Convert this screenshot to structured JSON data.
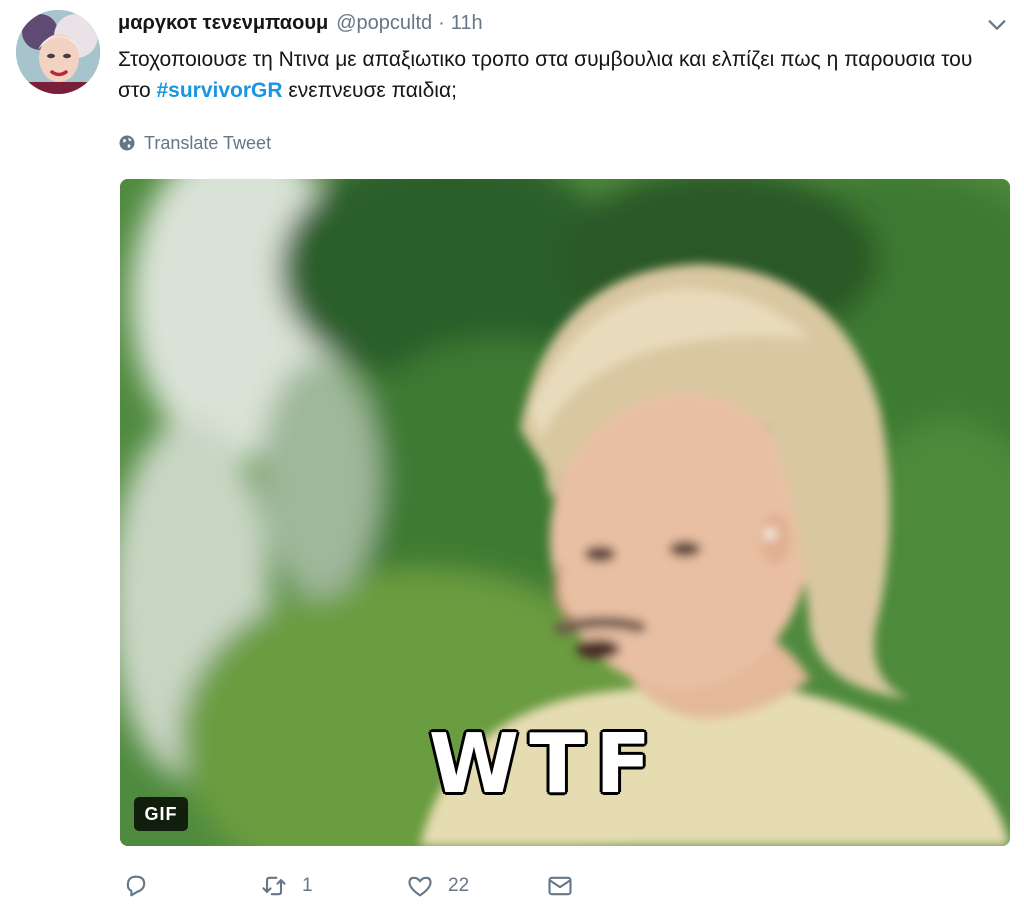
{
  "tweet": {
    "author_name": "μαργκοτ τενενμπαουμ",
    "handle": "@popcultd",
    "separator": "·",
    "time": "11h",
    "text_before": "Στοχοποιουσε τη Ντινα με απαξιωτικο τροπο στα συμβουλια και ελπίζει πως η παρουσια του στο ",
    "hashtag": "#survivorGR",
    "text_after": " ενεπνευσε παιδια;",
    "translate_label": "Translate Tweet",
    "media": {
      "caption": "WTF",
      "badge": "GIF"
    },
    "actions": {
      "reply_count": "",
      "retweet_count": "1",
      "like_count": "22"
    }
  },
  "icons": {
    "reply": "reply-icon",
    "retweet": "retweet-icon",
    "like": "heart-icon",
    "dm": "envelope-icon",
    "menu": "chevron-down-icon",
    "translate": "globe-icon"
  },
  "colors": {
    "link": "#1b95e0",
    "secondary": "#657786",
    "text": "#14171a"
  }
}
